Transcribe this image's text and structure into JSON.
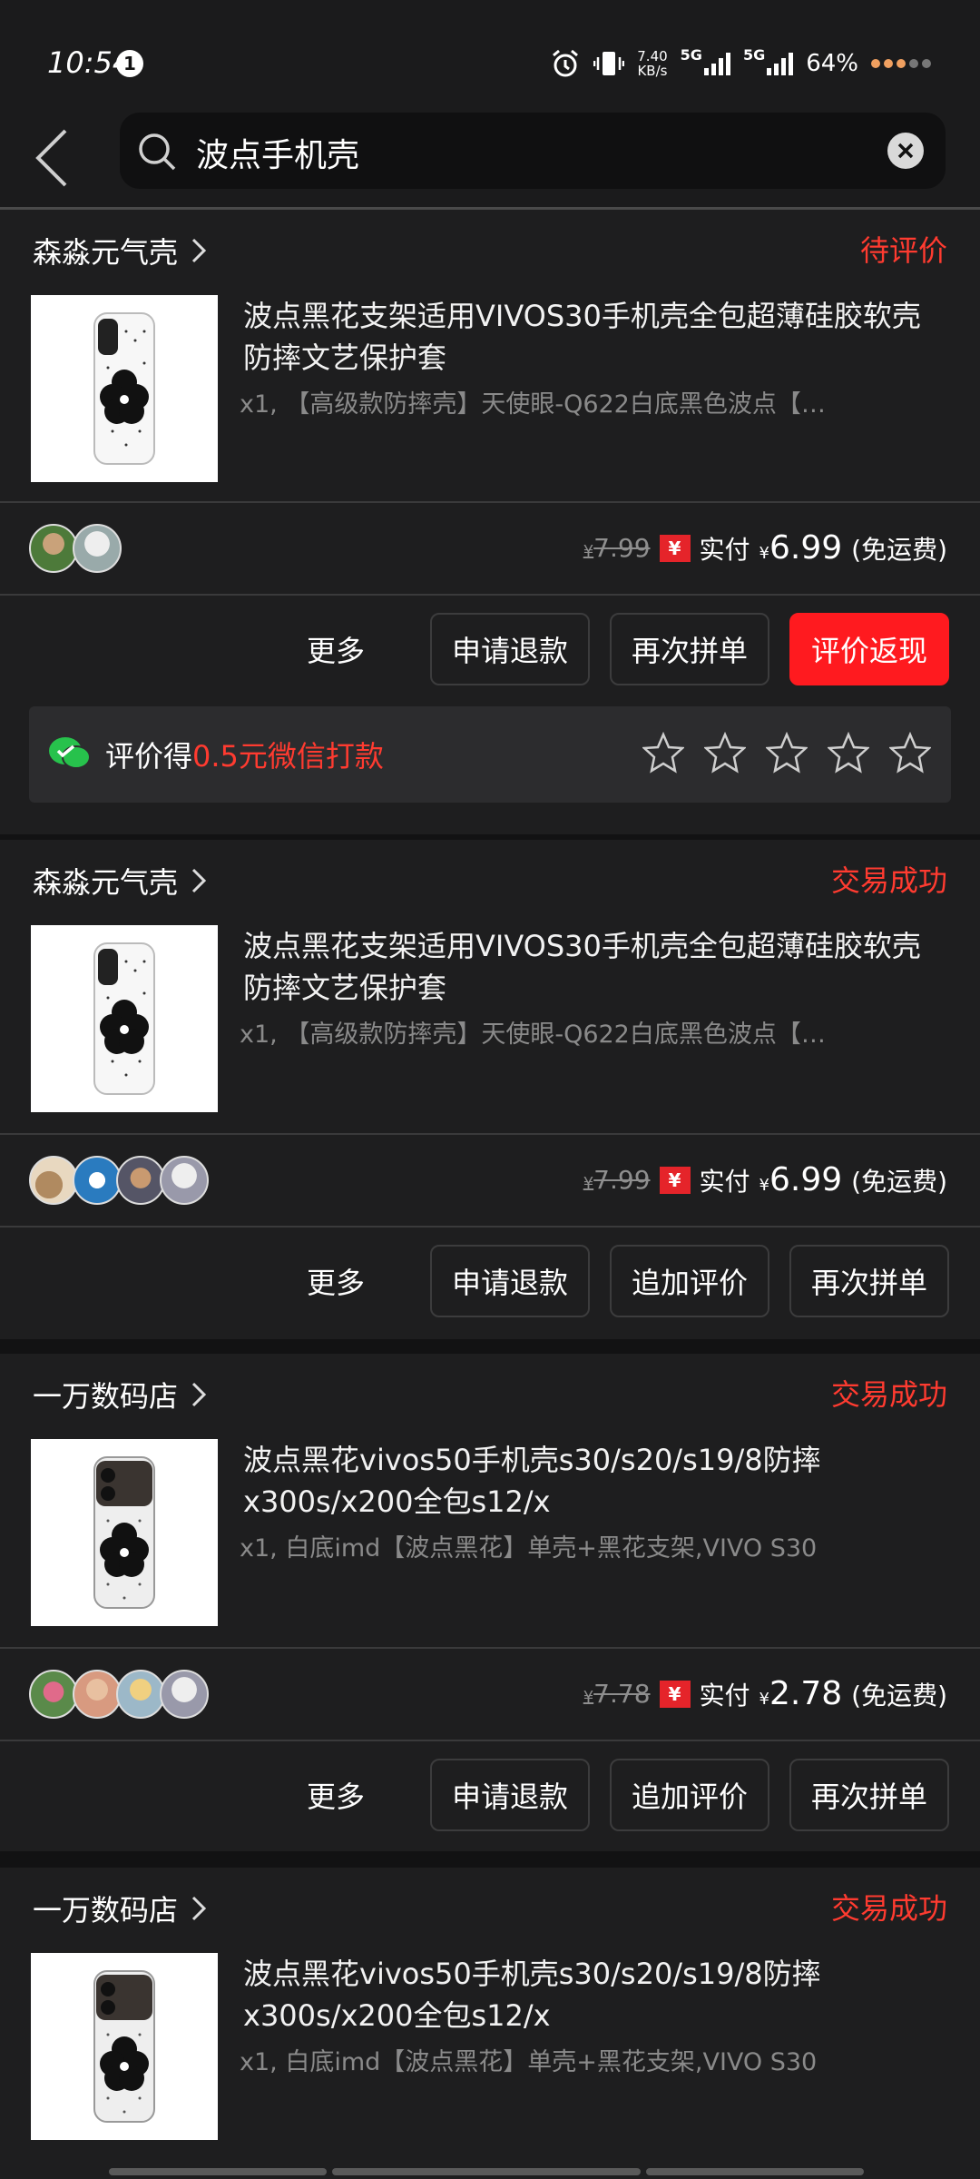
{
  "status_bar": {
    "time": "10:54",
    "notification_count": "1",
    "net_speed_top": "7.40",
    "net_speed_unit": "KB/s",
    "sim1": "5G",
    "sim2": "5G",
    "battery": "64%"
  },
  "header": {
    "search_query": "波点手机壳"
  },
  "orders": [
    {
      "store": "森淼元气壳",
      "status": "待评价",
      "title": "波点黑花支架适用VIVOS30手机壳全包超薄硅胶软壳防摔文艺保护套",
      "spec": "x1, 【高级款防摔壳】天使眼-Q622白底黑色波点【…",
      "orig_price": "7.99",
      "paid_label": "实付",
      "paid_yen": "¥",
      "paid": "6.99",
      "shipping": "(免运费)",
      "buttons": [
        "更多",
        "申请退款",
        "再次拼单",
        "评价返现"
      ],
      "review_prefix": "评价得",
      "review_highlight": "0.5元微信打款",
      "rating_max": 5
    },
    {
      "store": "森淼元气壳",
      "status": "交易成功",
      "title": "波点黑花支架适用VIVOS30手机壳全包超薄硅胶软壳防摔文艺保护套",
      "spec": "x1, 【高级款防摔壳】天使眼-Q622白底黑色波点【…",
      "orig_price": "7.99",
      "paid_label": "实付",
      "paid_yen": "¥",
      "paid": "6.99",
      "shipping": "(免运费)",
      "buttons": [
        "更多",
        "申请退款",
        "追加评价",
        "再次拼单"
      ]
    },
    {
      "store": "一万数码店",
      "status": "交易成功",
      "title": "波点黑花vivos50手机壳s30/s20/s19/8防摔x300s/x200全包s12/x",
      "spec": "x1, 白底imd【波点黑花】单壳+黑花支架,VIVO S30",
      "orig_price": "7.78",
      "paid_label": "实付",
      "paid_yen": "¥",
      "paid": "2.78",
      "shipping": "(免运费)",
      "buttons": [
        "更多",
        "申请退款",
        "追加评价",
        "再次拼单"
      ]
    },
    {
      "store": "一万数码店",
      "status": "交易成功",
      "title": "波点黑花vivos50手机壳s30/s20/s19/8防摔x300s/x200全包s12/x",
      "spec": "x1, 白底imd【波点黑花】单壳+黑花支架,VIVO S30"
    }
  ],
  "colors": {
    "accent_red": "#ff1a1f",
    "status_red": "#ff3b30",
    "background": "#1b1b1c"
  },
  "icons": [
    "back-arrow-icon",
    "search-icon",
    "clear-icon",
    "chevron-right-icon",
    "wechat-icon",
    "star-icon",
    "alarm-icon",
    "vibrate-icon"
  ]
}
